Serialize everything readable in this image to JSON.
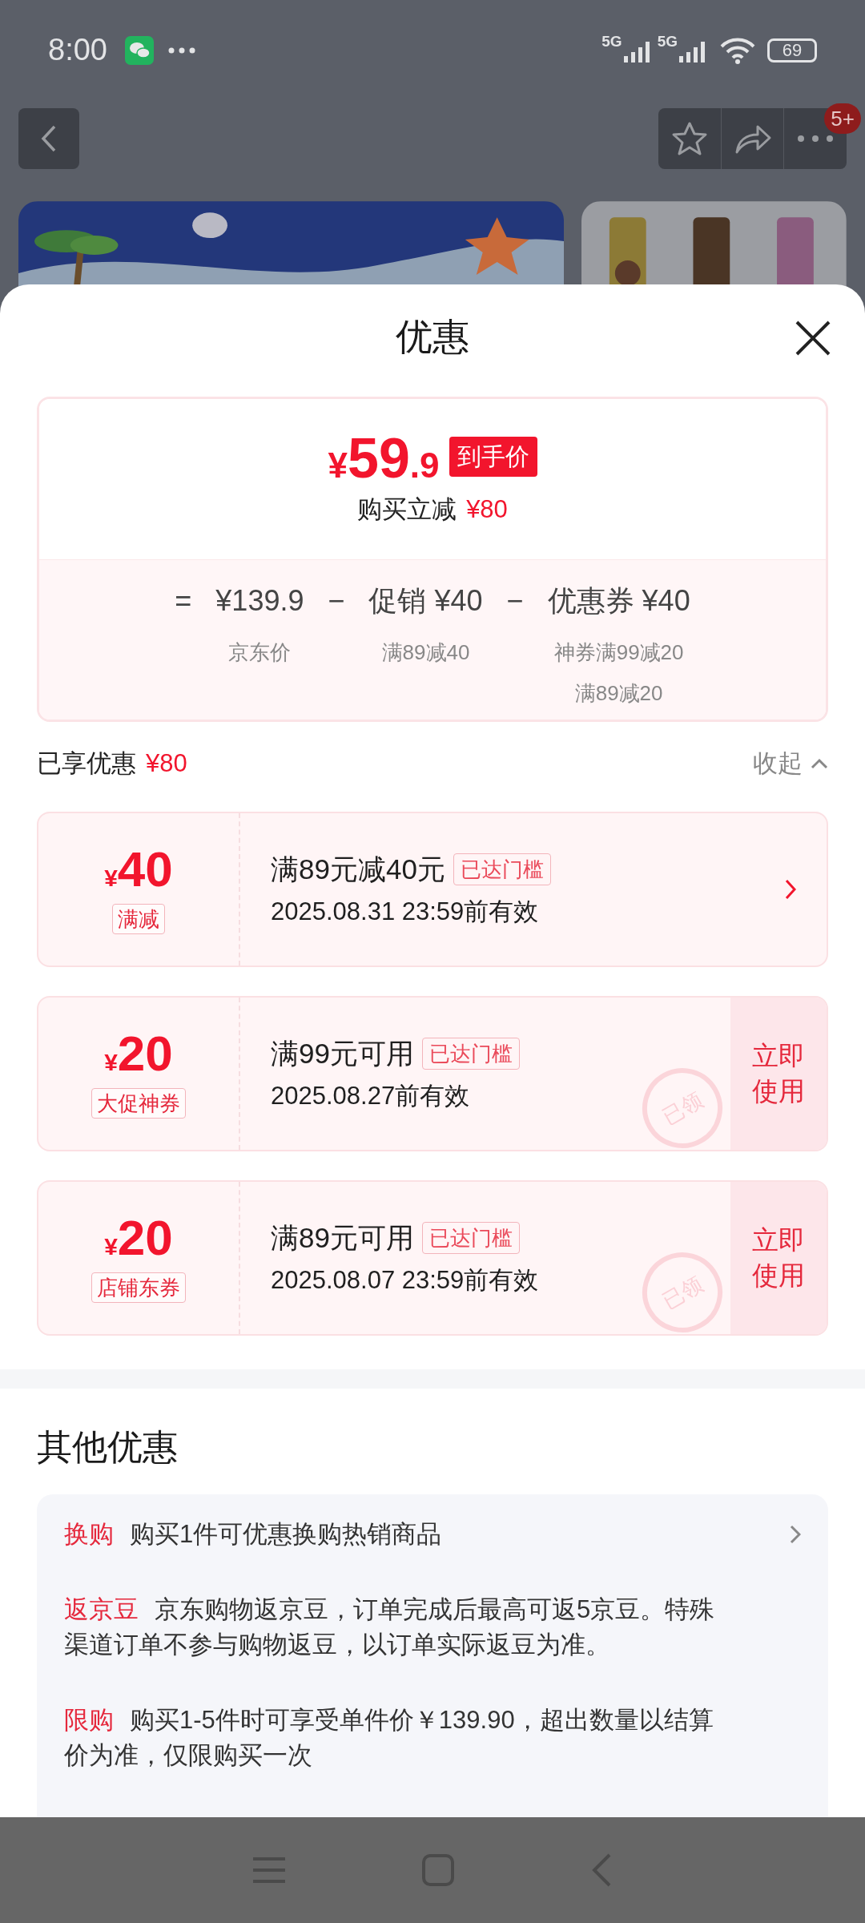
{
  "status_bar": {
    "time": "8:00",
    "network_1": "5G",
    "network_2": "5G",
    "battery": "69"
  },
  "nav": {
    "badge": "5+"
  },
  "sheet": {
    "title": "优惠"
  },
  "summary": {
    "currency": "¥",
    "price_int": "59",
    "price_dec": ".9",
    "tag": "到手价",
    "saving_label": "购买立减",
    "saving": "¥80",
    "terms": [
      {
        "op": "=",
        "value": "¥139.9",
        "notes": [
          "京东价"
        ]
      },
      {
        "op": "−",
        "value": "促销 ¥40",
        "notes": [
          "满89减40"
        ]
      },
      {
        "op": "−",
        "value": "优惠券 ¥40",
        "notes": [
          "神券满99减20",
          "满89减20"
        ]
      }
    ]
  },
  "enjoyed": {
    "label": "已享优惠",
    "amount": "¥80",
    "toggle": "收起"
  },
  "coupons": [
    {
      "kind": "arrow",
      "currency": "¥",
      "amount": "40",
      "type": "满减",
      "title": "满89元减40元",
      "badge": "已达门槛",
      "validity": "2025.08.31 23:59前有效"
    },
    {
      "kind": "use",
      "currency": "¥",
      "amount": "20",
      "type": "大促神券",
      "title": "满99元可用",
      "badge": "已达门槛",
      "validity": "2025.08.27前有效",
      "action": "立即使用",
      "stamp": "已领"
    },
    {
      "kind": "use",
      "currency": "¥",
      "amount": "20",
      "type": "店铺东券",
      "title": "满89元可用",
      "badge": "已达门槛",
      "validity": "2025.08.07 23:59前有效",
      "action": "立即使用",
      "stamp": "已领"
    }
  ],
  "other": {
    "title": "其他优惠",
    "items": [
      {
        "label": "换购",
        "text": "购买1件可优惠换购热销商品",
        "link": true
      },
      {
        "label": "返京豆",
        "text": "京东购物返京豆，订单完成后最高可返5京豆。特殊渠道订单不参与购物返豆，以订单实际返豆为准。",
        "link": false
      },
      {
        "label": "限购",
        "text": "购买1-5件时可享受单件价￥139.90，超出数量以结算价为准，仅限购买一次",
        "link": false
      }
    ]
  }
}
